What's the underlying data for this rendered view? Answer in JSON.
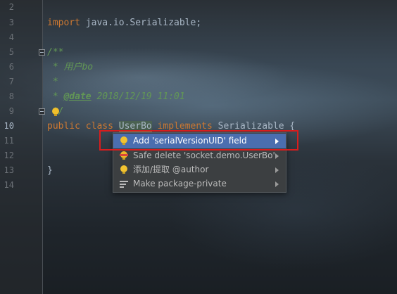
{
  "editor": {
    "line_numbers": [
      "2",
      "3",
      "4",
      "5",
      "6",
      "7",
      "8",
      "9",
      "10",
      "11",
      "12",
      "13",
      "14"
    ],
    "current_line": "10",
    "import_kw": "import",
    "import_path": " java.io.Serializable;",
    "javadoc_open": "/**",
    "javadoc_user": " * 用户bo",
    "javadoc_star": " *",
    "javadoc_star_prefix": " * ",
    "javadoc_tag": "@date",
    "javadoc_date": " 2018/12/19 11:01",
    "javadoc_close": " */",
    "class_public": "public ",
    "class_kw": "class ",
    "class_name": "UserBo",
    "implements_kw": " implements ",
    "interface_name": "Serializable {",
    "closing_brace": "}"
  },
  "context_menu": {
    "items": [
      {
        "label": "Add 'serialVersionUID' field",
        "icon": "lightbulb-icon",
        "selected": true
      },
      {
        "label": "Safe delete 'socket.demo.UserBo'",
        "icon": "lightbulb-delete-icon",
        "selected": false
      },
      {
        "label": "添加/提取 @author",
        "icon": "lightbulb-icon",
        "selected": false
      },
      {
        "label": "Make package-private",
        "icon": "package-private-icon",
        "selected": false
      }
    ]
  },
  "colors": {
    "keyword": "#cc7832",
    "javadoc": "#629755",
    "selection": "#4b6eaf",
    "highlight_border": "#d81d1d"
  }
}
